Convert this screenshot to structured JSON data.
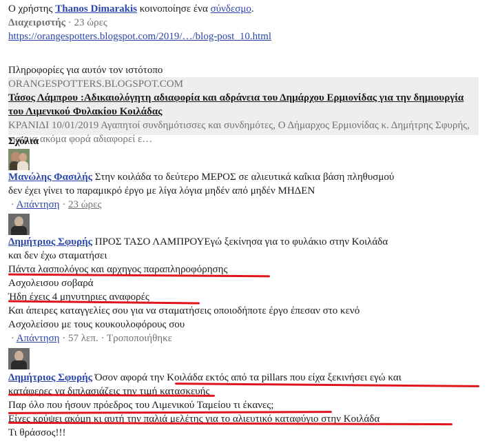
{
  "post": {
    "prefix": "Ο χρήστης",
    "author": "Thanos Dimarakis",
    "middle": "κοινοποίησε ένα",
    "link_word": "σύνδεσμο",
    "end": ".",
    "role": "Διαχειριστής",
    "time": "· 23 ώρες",
    "url": "https://orangespotters.blogspot.com/2019/…/blog-post_10.html"
  },
  "preview": {
    "info": "Πληροφορίες για αυτόν τον ιστότοπο",
    "domain": "ORANGESPOTTERS.BLOGSPOT.COM",
    "title": "Τάσος Λάμπρου :Αδικαιολόγητη αδιαφορία και αδράνεια του Δημάρχου Ερμιονίδας για την δημιουργία του Λιμενικού Φυλακίου Κοιλάδας",
    "desc": "ΚΡΑΝΙΔΙ 10/01/2019 Αγαπητοί συνδημότισσες και συνδημότες, Ο Δήμαρχος Ερμιονίδας κ. Δημήτρης Σφυρής, για μια ακόμα φορά αδιαφορεί ε…"
  },
  "comments_header": "Σχόλια",
  "comments": [
    {
      "name": "Μανώλης Φασιλής",
      "lines": [
        "Στην κοιλάδα το δεύτερο ΜΕΡΟΣ σε αλιευτικά καΐκια βάση πληθυσμού",
        "δεν έχει γίνει το παραμικρό έργο με λίγα λόγια μηδέν από μηδέν ΜΗΔΕΝ"
      ],
      "reply": "Απάντηση",
      "time": "23 ώρες"
    },
    {
      "name": "Δημήτριος Σφυρής",
      "lines": [
        "ΠΡΟΣ ΤΑΣΟ ΛΑΜΠΡΟΥΕγώ ξεκίνησα για το φυλάκιο στην Κοιλάδα",
        "και δεν έχω σταματήσει",
        "Πάντα λασπολόγος και αρχηγος παραπληροφόρησης",
        "Ασχολεισου σοβαρά",
        "Ήδη έχεις 4 μηνυτηριες αναφορές",
        "Και άπειρες καταγγελίες σου για να σταματήσεις οποιοδήποτε έργο έπεσαν στο κενό",
        "Ασχολείσου με τους κουκουλοφόρους σου"
      ],
      "reply": "Απάντηση",
      "time": "57 λεπ.",
      "edit": "Τροποποιήθηκε"
    },
    {
      "name": "Δημήτριος Σφυρής",
      "lines": [
        "Όσον αφορά την Κοιλάδα εκτός από τα pillars που είχα ξεκινήσει εγώ και",
        "κατάφερες να διπλασιάζεις την τιμή κατασκευής",
        "Παρ όλο που ήσουν πρόεδρος του Λιμενικού Ταμείου τι έκανες;",
        "Είχες κρύψει ακόμη κι αυτή την παλιά μελέτης για το αλιευτικό καταφύγιο στην Κοιλάδα",
        "Τι θράσσος!!!"
      ]
    }
  ],
  "colors": {
    "link": "#2a46a8",
    "annotation": "#e0141c",
    "preview_bg": "#eeeeee"
  }
}
